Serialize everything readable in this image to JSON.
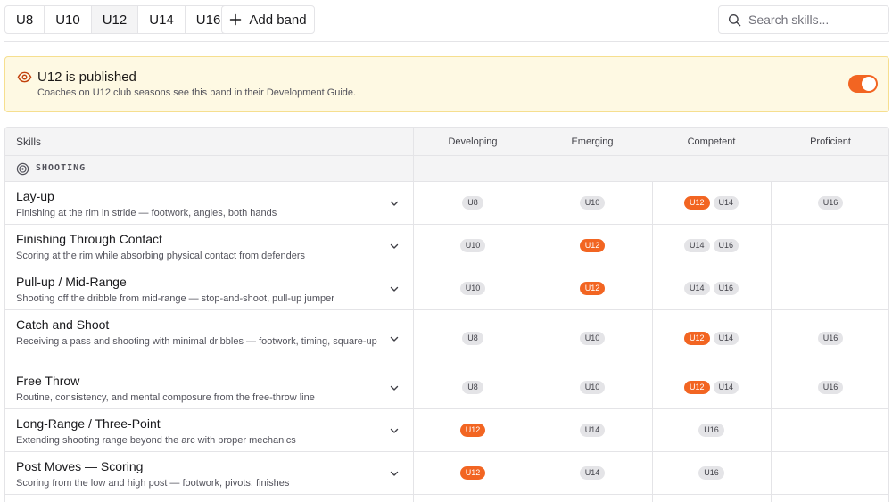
{
  "bands": [
    "U8",
    "U10",
    "U12",
    "U14",
    "U16"
  ],
  "active_band": "U12",
  "add_band_label": "Add band",
  "search": {
    "placeholder": "Search skills..."
  },
  "banner": {
    "title": "U12 is published",
    "subtitle": "Coaches on U12 club seasons see this band in their Development Guide.",
    "published": true
  },
  "table": {
    "skills_header": "Skills",
    "levels": [
      "Developing",
      "Emerging",
      "Competent",
      "Proficient"
    ],
    "group": "SHOOTING",
    "rows": [
      {
        "name": "Lay-up",
        "desc": "Finishing at the rim in stride — footwork, angles, both hands",
        "cells": [
          [
            "U8"
          ],
          [
            "U10"
          ],
          [
            "U12",
            "U14"
          ],
          [
            "U16"
          ]
        ]
      },
      {
        "name": "Finishing Through Contact",
        "desc": "Scoring at the rim while absorbing physical contact from defenders",
        "cells": [
          [
            "U10"
          ],
          [
            "U12"
          ],
          [
            "U14",
            "U16"
          ],
          []
        ]
      },
      {
        "name": "Pull-up / Mid-Range",
        "desc": "Shooting off the dribble from mid-range — stop-and-shoot, pull-up jumper",
        "cells": [
          [
            "U10"
          ],
          [
            "U12"
          ],
          [
            "U14",
            "U16"
          ],
          []
        ]
      },
      {
        "name": "Catch and Shoot",
        "desc": "Receiving a pass and shooting with minimal dribbles — footwork, timing, square-up",
        "cells": [
          [
            "U8"
          ],
          [
            "U10"
          ],
          [
            "U12",
            "U14"
          ],
          [
            "U16"
          ]
        ]
      },
      {
        "name": "Free Throw",
        "desc": "Routine, consistency, and mental composure from the free-throw line",
        "cells": [
          [
            "U8"
          ],
          [
            "U10"
          ],
          [
            "U12",
            "U14"
          ],
          [
            "U16"
          ]
        ]
      },
      {
        "name": "Long-Range / Three-Point",
        "desc": "Extending shooting range beyond the arc with proper mechanics",
        "cells": [
          [
            "U12"
          ],
          [
            "U14"
          ],
          [
            "U16"
          ],
          []
        ]
      },
      {
        "name": "Post Moves — Scoring",
        "desc": "Scoring from the low and high post — footwork, pivots, finishes",
        "cells": [
          [
            "U12"
          ],
          [
            "U14"
          ],
          [
            "U16"
          ],
          []
        ]
      }
    ]
  },
  "colors": {
    "accent": "#f26522",
    "banner_bg": "#fef9e3",
    "banner_border": "#f6df8f",
    "chip_bg": "#e4e4e7"
  },
  "icons": {
    "search": "search-icon",
    "add": "plus-icon",
    "eye": "eye-icon",
    "group": "target-icon",
    "expand": "chevron-down-icon"
  }
}
